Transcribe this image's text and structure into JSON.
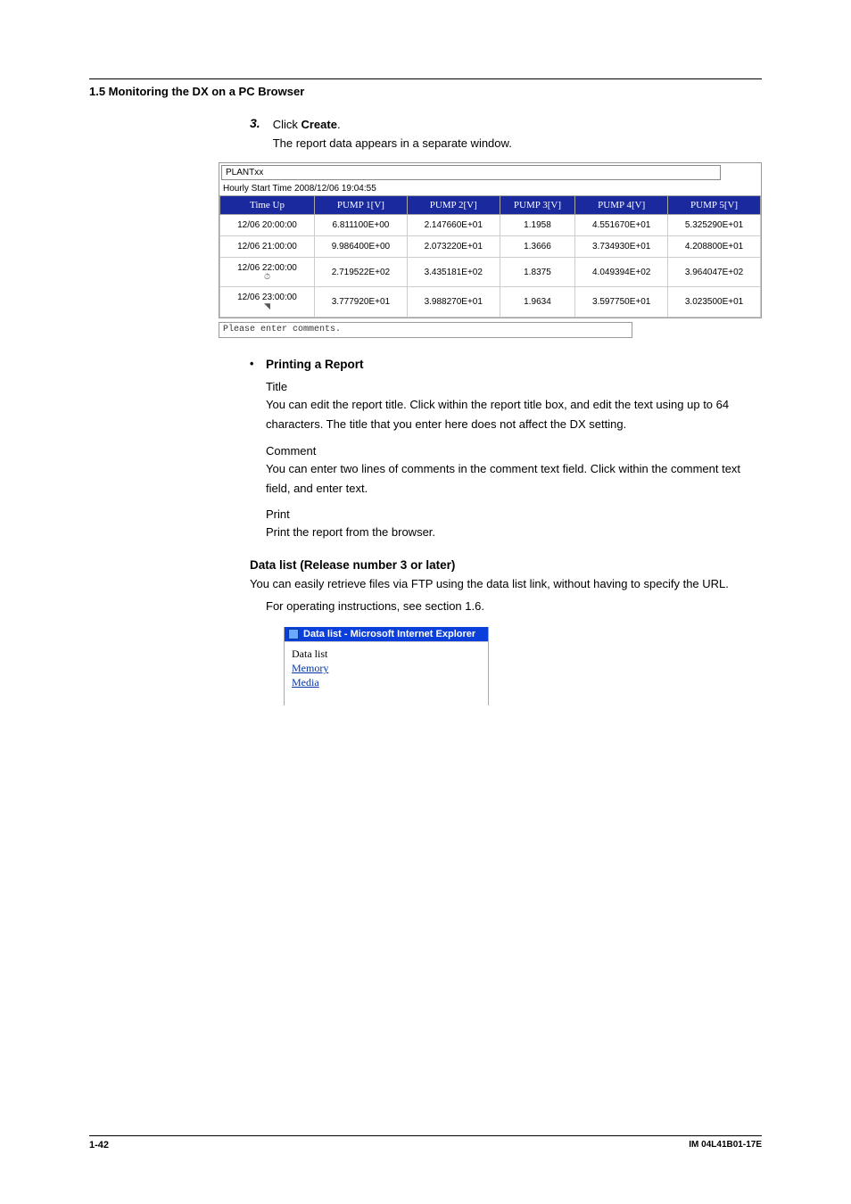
{
  "header": {
    "section": "1.5  Monitoring the DX on a PC Browser"
  },
  "step": {
    "num": "3.",
    "text_prefix": "Click ",
    "text_bold": "Create",
    "text_suffix": ".",
    "text_line2": "The report data appears in a separate window."
  },
  "report": {
    "title_input": "PLANTxx",
    "subtitle": "Hourly Start Time 2008/12/06 19:04:55",
    "headers": [
      "Time Up",
      "PUMP 1[V]",
      "PUMP 2[V]",
      "PUMP 3[V]",
      "PUMP 4[V]",
      "PUMP 5[V]"
    ],
    "rows": [
      {
        "time": "12/06 20:00:00",
        "icon": "",
        "vals": [
          "6.811100E+00",
          "2.147660E+01",
          "1.1958",
          "4.551670E+01",
          "5.325290E+01"
        ]
      },
      {
        "time": "12/06 21:00:00",
        "icon": "",
        "vals": [
          "9.986400E+00",
          "2.073220E+01",
          "1.3666",
          "3.734930E+01",
          "4.208800E+01"
        ]
      },
      {
        "time": "12/06 22:00:00",
        "icon": "⏱",
        "vals": [
          "2.719522E+02",
          "3.435181E+02",
          "1.8375",
          "4.049394E+02",
          "3.964047E+02"
        ]
      },
      {
        "time": "12/06 23:00:00",
        "icon": "◥",
        "vals": [
          "3.777920E+01",
          "3.988270E+01",
          "1.9634",
          "3.597750E+01",
          "3.023500E+01"
        ]
      }
    ],
    "comment_placeholder": "Please enter comments."
  },
  "printing": {
    "heading": "Printing a Report",
    "title_label": "Title",
    "title_text": "You can edit the report title. Click within the report title box, and edit the text using up to 64 characters. The title that you enter here does not affect the DX setting.",
    "comment_label": "Comment",
    "comment_text": "You can enter two lines of comments in the comment text field. Click within the comment text field, and enter text.",
    "print_label": "Print",
    "print_text": "Print the report from the browser."
  },
  "datalist": {
    "heading": "Data list (Release number 3 or later)",
    "para1": "You can easily retrieve files via FTP using the data list link, without having to specify the URL.",
    "para2": "For operating instructions, see section 1.6.",
    "window_title": "Data list - Microsoft Internet Explorer",
    "body_title": "Data list",
    "link1": "Memory",
    "link2": "Media"
  },
  "footer": {
    "left": "1-42",
    "right": "IM 04L41B01-17E"
  },
  "chart_data": {
    "type": "table",
    "title": "PLANTxx",
    "subtitle": "Hourly Start Time 2008/12/06 19:04:55",
    "columns": [
      "Time Up",
      "PUMP 1[V]",
      "PUMP 2[V]",
      "PUMP 3[V]",
      "PUMP 4[V]",
      "PUMP 5[V]"
    ],
    "rows": [
      [
        "12/06 20:00:00",
        "6.811100E+00",
        "2.147660E+01",
        "1.1958",
        "4.551670E+01",
        "5.325290E+01"
      ],
      [
        "12/06 21:00:00",
        "9.986400E+00",
        "2.073220E+01",
        "1.3666",
        "3.734930E+01",
        "4.208800E+01"
      ],
      [
        "12/06 22:00:00",
        "2.719522E+02",
        "3.435181E+02",
        "1.8375",
        "4.049394E+02",
        "3.964047E+02"
      ],
      [
        "12/06 23:00:00",
        "3.777920E+01",
        "3.988270E+01",
        "1.9634",
        "3.597750E+01",
        "3.023500E+01"
      ]
    ]
  }
}
